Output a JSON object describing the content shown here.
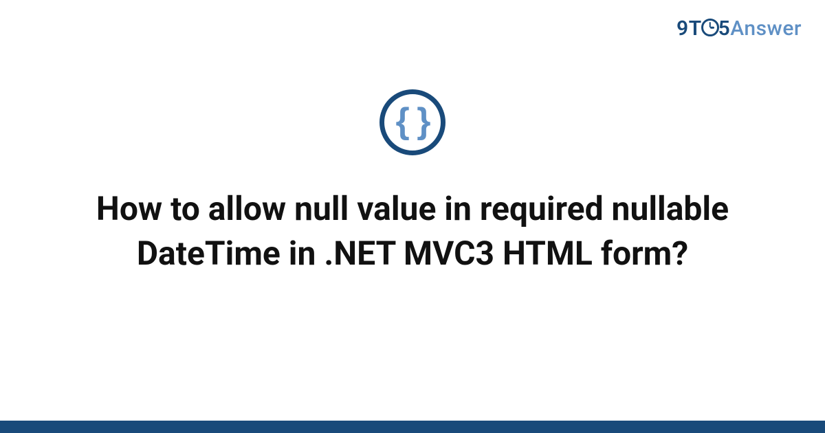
{
  "brand": {
    "part1": "9",
    "part2": "T",
    "part3": "5",
    "part4": "Answer"
  },
  "icon": {
    "glyph": "{ }"
  },
  "question": {
    "title": "How to allow null value in required nullable DateTime in .NET MVC3 HTML form?"
  },
  "colors": {
    "primary": "#194a7a",
    "accent": "#5f90c5"
  }
}
